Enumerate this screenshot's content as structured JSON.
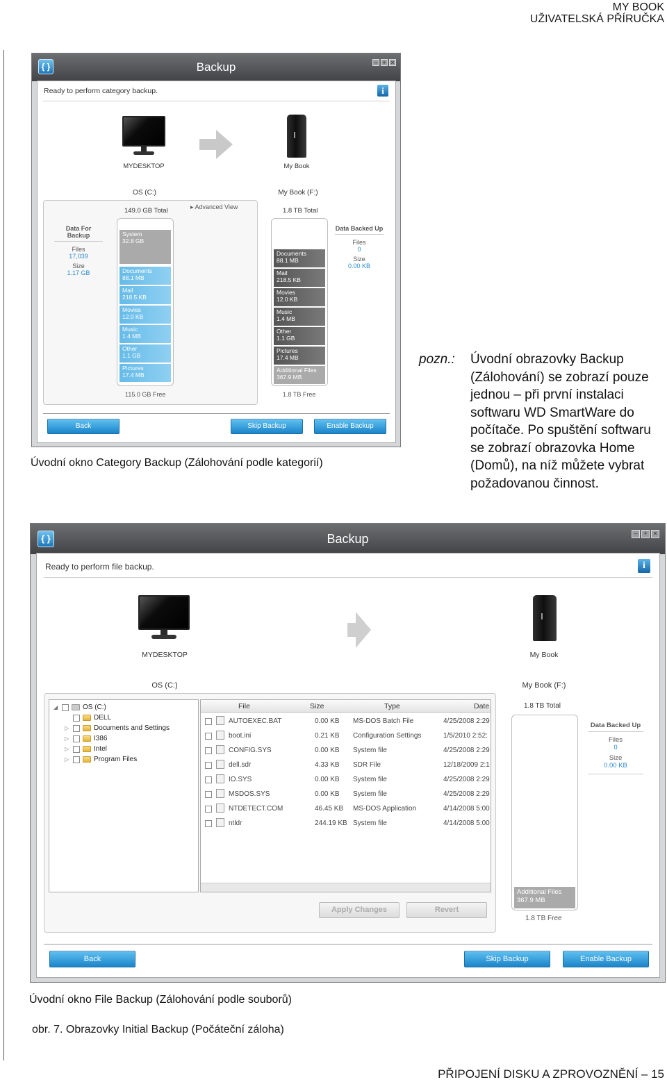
{
  "header": {
    "line1": "MY BOOK",
    "line2": "UŽIVATELSKÁ PŘÍRUČKA"
  },
  "note": {
    "label": "pozn.:",
    "text": "Úvodní obrazovky Backup (Zálohování) se zobrazí pouze jednou – při první instalaci softwaru WD SmartWare do počítače. Po spuštění softwaru se zobrazí obrazovka Home (Domů), na níž můžete vybrat požadovanou činnost."
  },
  "caption1": "Úvodní okno Category Backup (Zálohování podle kategorií)",
  "caption2": "Úvodní okno File Backup (Zálohování podle souborů)",
  "figure_caption": "obr. 7.  Obrazovky Initial Backup (Počáteční záloha)",
  "footer": "PŘIPOJENÍ DISKU A ZPROVOZNĚNÍ – 15",
  "icons": [
    "app-logo-icon",
    "info-icon",
    "monitor-icon",
    "drive-icon",
    "arrow-right-icon",
    "folder-icon",
    "file-icon"
  ],
  "win1": {
    "title": "Backup",
    "status": "Ready to perform category backup.",
    "info": "i",
    "computer": "MYDESKTOP",
    "drive": "My Book",
    "left_vol": "OS (C:)",
    "right_vol": "My Book (F:)",
    "left_total": "149.0 GB Total",
    "right_total": "1.8 TB Total",
    "advanced": "▸ Advanced View",
    "left_free": "115.0 GB Free",
    "right_free": "1.8 TB Free",
    "left_side": {
      "head": "Data For Backup",
      "files_l": "Files",
      "files_v": "17,039",
      "size_l": "Size",
      "size_v": "1.17 GB"
    },
    "right_side": {
      "head": "Data Backed Up",
      "files_l": "Files",
      "files_v": "0",
      "size_l": "Size",
      "size_v": "0.00 KB"
    },
    "left_segs": [
      {
        "name": "System",
        "size": "32.8 GB"
      },
      {
        "name": "Documents",
        "size": "88.1 MB"
      },
      {
        "name": "Mail",
        "size": "218.5 KB"
      },
      {
        "name": "Movies",
        "size": "12.0 KB"
      },
      {
        "name": "Music",
        "size": "1.4 MB"
      },
      {
        "name": "Other",
        "size": "1.1 GB"
      },
      {
        "name": "Pictures",
        "size": "17.4 MB"
      }
    ],
    "right_segs": [
      {
        "name": "Documents",
        "size": "88.1 MB"
      },
      {
        "name": "Mail",
        "size": "218.5 KB"
      },
      {
        "name": "Movies",
        "size": "12.0 KB"
      },
      {
        "name": "Music",
        "size": "1.4 MB"
      },
      {
        "name": "Other",
        "size": "1.1 GB"
      },
      {
        "name": "Pictures",
        "size": "17.4 MB"
      },
      {
        "name": "Additional Files",
        "size": "367.9 MB"
      }
    ],
    "buttons": {
      "back": "Back",
      "skip": "Skip Backup",
      "enable": "Enable Backup"
    }
  },
  "win2": {
    "title": "Backup",
    "status": "Ready to perform file backup.",
    "info": "i",
    "computer": "MYDESKTOP",
    "drive": "My Book",
    "left_vol": "OS (C:)",
    "right_vol": "My Book (F:)",
    "right_total": "1.8 TB Total",
    "right_free": "1.8 TB Free",
    "right_side": {
      "head": "Data Backed Up",
      "files_l": "Files",
      "files_v": "0",
      "size_l": "Size",
      "size_v": "0.00 KB"
    },
    "additional": {
      "name": "Additional Files",
      "size": "367.9 MB"
    },
    "tree": [
      {
        "label": "OS (C:)",
        "level": 0,
        "expander": "◢"
      },
      {
        "label": "DELL",
        "level": 1,
        "expander": ""
      },
      {
        "label": "Documents and Settings",
        "level": 1,
        "expander": "▷"
      },
      {
        "label": "I386",
        "level": 1,
        "expander": "▷"
      },
      {
        "label": "Intel",
        "level": 1,
        "expander": "▷"
      },
      {
        "label": "Program Files",
        "level": 1,
        "expander": "▷"
      }
    ],
    "columns": {
      "file": "File",
      "size": "Size",
      "type": "Type",
      "date": "Date"
    },
    "files": [
      {
        "file": "AUTOEXEC.BAT",
        "size": "0.00 KB",
        "type": "MS-DOS Batch File",
        "date": "4/25/2008 2:29"
      },
      {
        "file": "boot.ini",
        "size": "0.21 KB",
        "type": "Configuration Settings",
        "date": "1/5/2010 2:52:"
      },
      {
        "file": "CONFIG.SYS",
        "size": "0.00 KB",
        "type": "System file",
        "date": "4/25/2008 2:29"
      },
      {
        "file": "dell.sdr",
        "size": "4.33 KB",
        "type": "SDR File",
        "date": "12/18/2009 2:1"
      },
      {
        "file": "IO.SYS",
        "size": "0.00 KB",
        "type": "System file",
        "date": "4/25/2008 2:29"
      },
      {
        "file": "MSDOS.SYS",
        "size": "0.00 KB",
        "type": "System file",
        "date": "4/25/2008 2:29"
      },
      {
        "file": "NTDETECT.COM",
        "size": "46.45 KB",
        "type": "MS-DOS Application",
        "date": "4/14/2008 5:00"
      },
      {
        "file": "ntldr",
        "size": "244.19 KB",
        "type": "System file",
        "date": "4/14/2008 5:00"
      }
    ],
    "apply": "Apply Changes",
    "revert": "Revert",
    "buttons": {
      "back": "Back",
      "skip": "Skip Backup",
      "enable": "Enable Backup"
    }
  }
}
